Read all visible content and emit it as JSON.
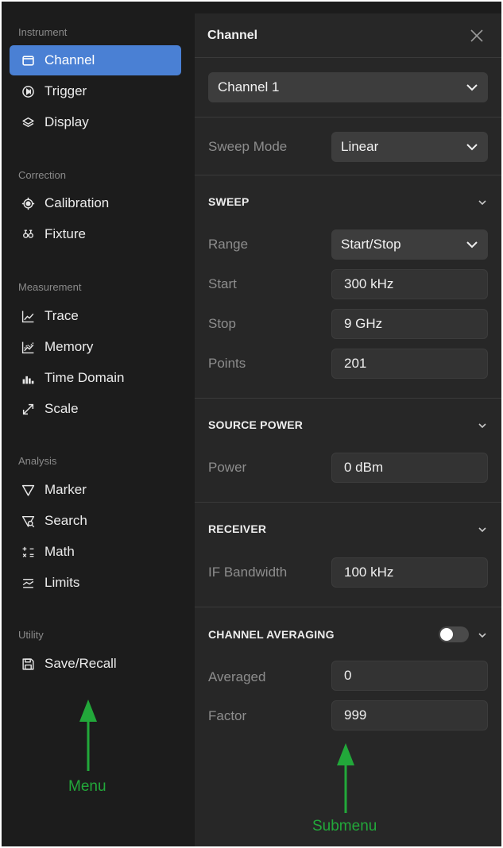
{
  "menu": {
    "sections": {
      "instrument": "Instrument",
      "correction": "Correction",
      "measurement": "Measurement",
      "analysis": "Analysis",
      "utility": "Utility"
    },
    "items": {
      "channel": "Channel",
      "trigger": "Trigger",
      "display": "Display",
      "calibration": "Calibration",
      "fixture": "Fixture",
      "trace": "Trace",
      "memory": "Memory",
      "time_domain": "Time Domain",
      "scale": "Scale",
      "marker": "Marker",
      "search": "Search",
      "math": "Math",
      "limits": "Limits",
      "save_recall": "Save/Recall"
    },
    "active_item": "channel",
    "active_color": "#4a80d4"
  },
  "panel": {
    "title": "Channel",
    "channel_select": "Channel 1",
    "sweep_mode": {
      "label": "Sweep Mode",
      "value": "Linear"
    },
    "sweep": {
      "header": "SWEEP",
      "range": {
        "label": "Range",
        "value": "Start/Stop"
      },
      "start": {
        "label": "Start",
        "value": "300 kHz"
      },
      "stop": {
        "label": "Stop",
        "value": "9 GHz"
      },
      "points": {
        "label": "Points",
        "value": "201"
      }
    },
    "source_power": {
      "header": "SOURCE POWER",
      "power": {
        "label": "Power",
        "value": "0 dBm"
      }
    },
    "receiver": {
      "header": "RECEIVER",
      "if_bandwidth": {
        "label": "IF Bandwidth",
        "value": "100 kHz"
      }
    },
    "channel_averaging": {
      "header": "CHANNEL AVERAGING",
      "enabled": false,
      "averaged": {
        "label": "Averaged",
        "value": "0"
      },
      "factor": {
        "label": "Factor",
        "value": "999"
      }
    }
  },
  "annotations": {
    "menu": "Menu",
    "submenu": "Submenu",
    "color": "#22a83a"
  }
}
